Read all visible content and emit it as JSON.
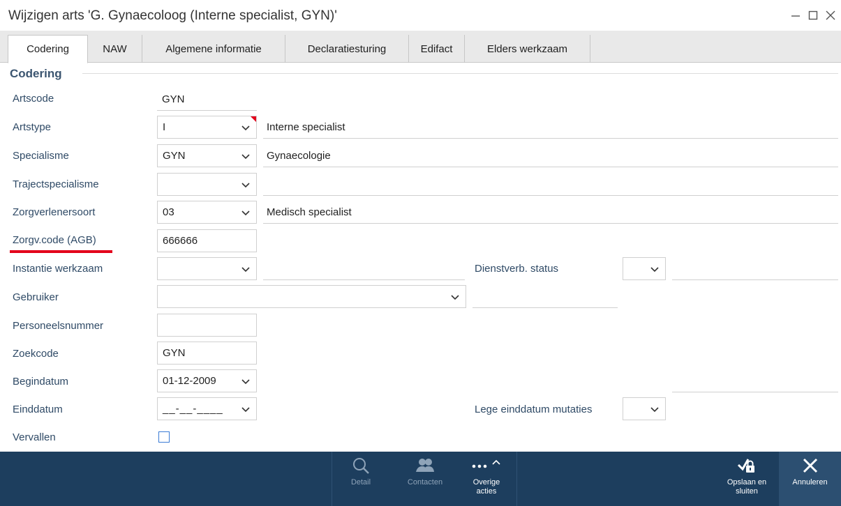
{
  "window": {
    "title": "Wijzigen arts 'G. Gynaecoloog (Interne specialist, GYN)'"
  },
  "tabs": [
    {
      "label": "Codering",
      "active": true
    },
    {
      "label": "NAW"
    },
    {
      "label": "Algemene informatie"
    },
    {
      "label": "Declaratiesturing"
    },
    {
      "label": "Edifact"
    },
    {
      "label": "Elders werkzaam"
    }
  ],
  "section": {
    "title": "Codering"
  },
  "form": {
    "artscode": {
      "label": "Artscode",
      "value": "GYN"
    },
    "artstype": {
      "label": "Artstype",
      "value": "I",
      "description": "Interne specialist"
    },
    "specialisme": {
      "label": "Specialisme",
      "value": "GYN",
      "description": "Gynaecologie"
    },
    "trajectspecialisme": {
      "label": "Trajectspecialisme",
      "value": "",
      "description": ""
    },
    "zorgverlenersoort": {
      "label": "Zorgverlenersoort",
      "value": "03",
      "description": "Medisch specialist"
    },
    "zorgv_code": {
      "label": "Zorgv.code (AGB)",
      "value": "666666"
    },
    "instantie_werkzaam": {
      "label": "Instantie werkzaam",
      "value": "",
      "description": ""
    },
    "dienstverb_status": {
      "label": "Dienstverb. status",
      "value": "",
      "description": ""
    },
    "gebruiker": {
      "label": "Gebruiker",
      "value": "",
      "description": ""
    },
    "personeelsnummer": {
      "label": "Personeelsnummer",
      "value": ""
    },
    "zoekcode": {
      "label": "Zoekcode",
      "value": "GYN"
    },
    "begindatum": {
      "label": "Begindatum",
      "value": "01-12-2009"
    },
    "einddatum": {
      "label": "Einddatum",
      "value": "__-__-____"
    },
    "lege_einddatum_mutaties": {
      "label": "Lege einddatum mutaties",
      "value": ""
    },
    "vervallen": {
      "label": "Vervallen",
      "checked": false
    }
  },
  "actions": {
    "detail": {
      "label": "Detail",
      "icon": "search-icon",
      "enabled": false
    },
    "contacten": {
      "label": "Contacten",
      "icon": "contacts-icon",
      "enabled": false
    },
    "overige": {
      "label_line1": "Overige",
      "label_line2": "acties",
      "icon": "more-icon",
      "enabled": true
    },
    "opslaan": {
      "label_line1": "Opslaan en",
      "label_line2": "sluiten",
      "icon": "save-close-icon",
      "enabled": true
    },
    "annuleren": {
      "label": "Annuleren",
      "icon": "close-icon",
      "enabled": true
    }
  },
  "colors": {
    "bottom_bar": "#1d3e5e",
    "label_text": "#2f4a66",
    "highlight_underline": "#e3001b",
    "required_marker": "#e3001b"
  }
}
